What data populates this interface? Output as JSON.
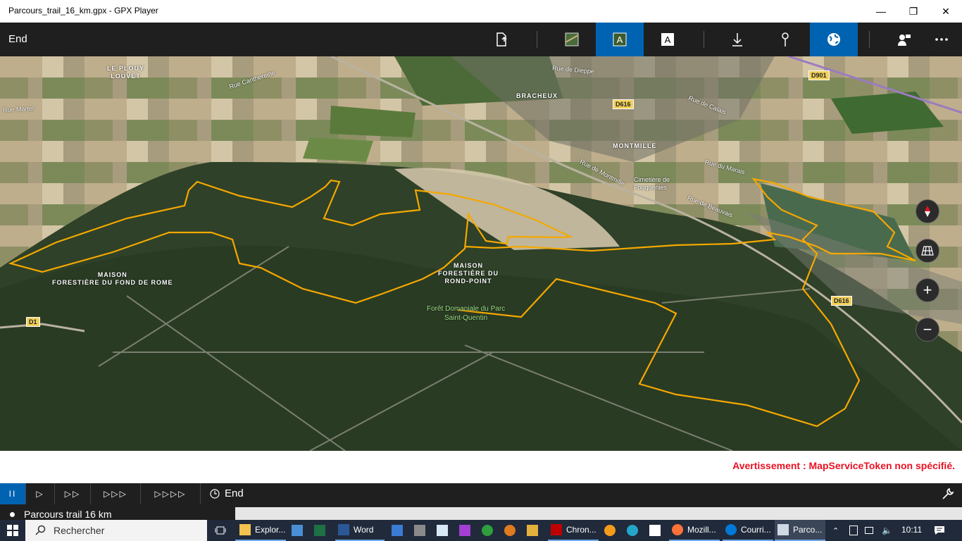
{
  "window": {
    "title": "Parcours_trail_16_km.gpx - GPX Player",
    "minimize": "—",
    "restore": "❐",
    "close": "✕"
  },
  "toolbar": {
    "label": "End",
    "buttons": [
      {
        "name": "export-icon"
      },
      {
        "name": "satellite-view-icon"
      },
      {
        "name": "aerial-labels-icon",
        "active": true
      },
      {
        "name": "road-labels-icon"
      },
      {
        "name": "download-icon"
      },
      {
        "name": "pin-icon"
      },
      {
        "name": "globe-icon",
        "active": true
      },
      {
        "name": "user-icon"
      },
      {
        "name": "more-icon"
      }
    ]
  },
  "map": {
    "places": [
      {
        "id": "le-plouy",
        "text": "LE PLOUY\nLOUVET"
      },
      {
        "id": "bracheux",
        "text": "BRACHEUX"
      },
      {
        "id": "montmille",
        "text": "MONTMILLE"
      },
      {
        "id": "maison-fond",
        "text": "MAISON\nFORESTIÈRE DU FOND DE ROME"
      },
      {
        "id": "maison-rond",
        "text": "MAISON\nFORESTIÈRE DU\nROND-POINT"
      }
    ],
    "roads": {
      "rue_martel": "Rue Martel",
      "rue_canthereine": "Rue Canthereine",
      "rue_dieppe": "Rue de Dieppe",
      "rue_calais": "Rue de Calais",
      "rue_marais": "Rue du Marais",
      "rue_beauvais": "Rue de Beauvais",
      "rue_montmille": "Rue de Montmille",
      "cimetiere": "Cimetière de Fouquenies"
    },
    "shields": {
      "d901": "D901",
      "d616a": "D616",
      "d616b": "D616",
      "d1": "D1"
    },
    "forest": "Forêt Domaniale du Parc\nSaint-Quentin",
    "route_color": "#f5a800",
    "controls": {
      "zoom_in": "+",
      "zoom_out": "−"
    }
  },
  "warning": "Avertissement : MapServiceToken non spécifié.",
  "playback": {
    "pause": "II",
    "speed1": "▷",
    "speed2": "▷▷",
    "speed3": "▷▷▷",
    "speed4": "▷▷▷▷",
    "end_label": "End"
  },
  "track": {
    "name": "Parcours trail 16 km"
  },
  "taskbar": {
    "search_placeholder": "Rechercher",
    "apps": [
      {
        "id": "explorer",
        "label": "Explor..."
      },
      {
        "id": "word",
        "label": "Word"
      },
      {
        "id": "chrono",
        "label": "Chron..."
      },
      {
        "id": "firefox",
        "label": "Mozill..."
      },
      {
        "id": "mail",
        "label": "Courri..."
      },
      {
        "id": "gpx",
        "label": "Parco..."
      }
    ],
    "time": "10:11"
  }
}
